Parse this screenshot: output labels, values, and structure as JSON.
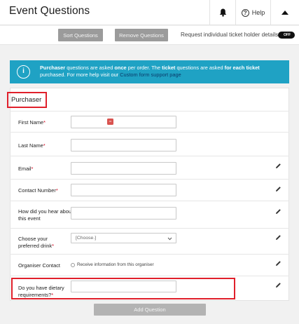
{
  "header": {
    "title": "Event Questions",
    "help_label": "Help"
  },
  "toolbar": {
    "sort_label": "Sort Questions",
    "remove_label": "Remove Questions",
    "ticket_details_label": "Request individual ticket holder details",
    "toggle_label": "OFF"
  },
  "banner": {
    "icon": "info-icon",
    "purchaser_word": "Purchaser",
    "text_1": " questions are asked ",
    "once_word": "once",
    "text_2": " per order. The ",
    "ticket_word": "ticket",
    "text_3": " questions are asked ",
    "each_ticket_word": "for each ticket",
    "text_4": " purchased. For more help visit our ",
    "link_text": "Custom form support page"
  },
  "section": {
    "title": "Purchaser"
  },
  "questions": [
    {
      "label": "First Name",
      "required": "*",
      "type": "text",
      "editable": false
    },
    {
      "label": "Last Name",
      "required": "*",
      "type": "text",
      "editable": false
    },
    {
      "label": "Email",
      "required": "*",
      "type": "text",
      "editable": true
    },
    {
      "label": "Contact Number",
      "required": "*",
      "type": "text",
      "editable": true
    },
    {
      "label": "How did you hear about this event",
      "required": "",
      "type": "text",
      "editable": true
    },
    {
      "label": "Choose your preferred drink",
      "required": "*",
      "type": "select",
      "value": "[Choose.]",
      "editable": true
    },
    {
      "label": "Organiser Contact",
      "required": "",
      "type": "radio",
      "option": "Receive information from this organiser",
      "editable": true
    },
    {
      "label": "Do you have dietary requirements?",
      "required": "*",
      "type": "text",
      "editable": true
    }
  ],
  "add_question_label": "Add Question",
  "colors": {
    "banner": "#1fa2c4",
    "highlight": "#e0202b",
    "required": "#d0021b"
  }
}
